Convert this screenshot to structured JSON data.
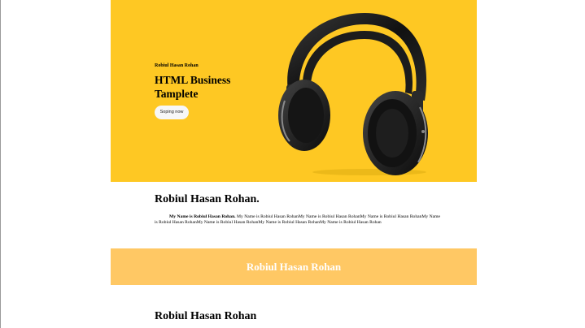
{
  "hero": {
    "small_label": "Robiul Hasan Rohan",
    "title": "HTML Business Tamplete",
    "button_label": "Soping now",
    "image_icon": "headphones-icon",
    "background_color": "#fec823"
  },
  "about": {
    "heading": "Robiul Hasan Rohan.",
    "lead_bold": "My Name is Robiul Hasan Rohan.",
    "body": " My Name is Robiul Hasan RohanMy Name is Robiul Hasan RohanMy Name is Robiul Hasan RohanMy Name is Robiul Hasan RohanMy Name is Robiul Hasan RohanMy Name is Robiul Hasan RohanMy Name is Robiul Hasan Rohan"
  },
  "band": {
    "text": "Robiul Hasan Rohan",
    "background_color": "#ffc864"
  },
  "section2": {
    "heading": "Robiul Hasan Rohan"
  }
}
